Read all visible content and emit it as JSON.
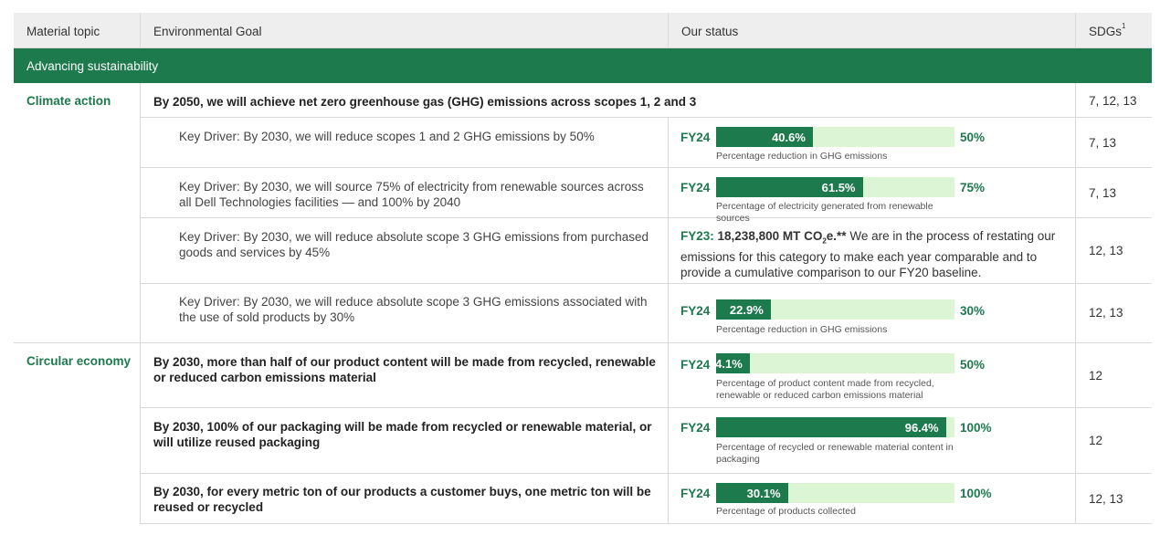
{
  "headers": {
    "topic": "Material topic",
    "goal": "Environmental Goal",
    "status": "Our status",
    "sdgs": "SDGs",
    "sdgs_sup": "1"
  },
  "section": "Advancing sustainability",
  "climate": {
    "topic": "Climate action",
    "main_goal": "By 2050, we will achieve net zero greenhouse gas (GHG) emissions across scopes 1, 2 and 3",
    "main_sdgs": "7, 12, 13",
    "drivers": [
      {
        "goal": "Key Driver: By 2030, we will reduce scopes 1 and 2 GHG emissions by 50%",
        "fy": "FY24",
        "progress": 0.406,
        "value": "40.6%",
        "target": "50%",
        "caption": "Percentage reduction in GHG emissions",
        "sdgs": "7, 13"
      },
      {
        "goal": "Key Driver: By 2030, we will source 75% of electricity from renewable sources across all Dell Technologies facilities — and 100% by 2040",
        "fy": "FY24",
        "progress": 0.615,
        "value": "61.5%",
        "target": "75%",
        "caption": "Percentage of electricity generated from renewable sources",
        "sdgs": "7, 13"
      },
      {
        "goal": "Key Driver: By 2030, we will reduce absolute scope 3 GHG emissions from purchased goods and services by 45%",
        "status_fy": "FY23:",
        "status_value": "18,238,800 MT CO",
        "status_sub": "2",
        "status_unit": "e.**",
        "status_text": "We are in the process of restating our emissions for this category to make each year comparable and to provide a cumulative comparison to our FY20 baseline.",
        "sdgs": "12, 13"
      },
      {
        "goal": "Key Driver: By 2030, we will reduce absolute scope 3 GHG emissions associated with the use of sold products by 30%",
        "fy": "FY24",
        "progress": 0.229,
        "value": "22.9%",
        "target": "30%",
        "caption": "Percentage reduction in GHG emissions",
        "sdgs": "12, 13"
      }
    ]
  },
  "circular": {
    "topic": "Circular economy",
    "goals": [
      {
        "goal": "By 2030, more than half of our product content will be made from recycled, renewable or reduced carbon emissions material",
        "fy": "FY24",
        "progress": 0.141,
        "value": "14.1%",
        "target": "50%",
        "caption": "Percentage of product content made from recycled, renewable or reduced carbon emissions material",
        "sdgs": "12"
      },
      {
        "goal": "By 2030, 100% of our packaging will be made from recycled or renewable material, or will utilize reused packaging",
        "fy": "FY24",
        "progress": 0.964,
        "value": "96.4%",
        "target": "100%",
        "caption": "Percentage of recycled or renewable material content in packaging",
        "sdgs": "12"
      },
      {
        "goal": "By 2030, for every metric ton of our products a customer buys, one metric ton will be reused or recycled",
        "fy": "FY24",
        "progress": 0.301,
        "value": "30.1%",
        "target": "100%",
        "caption": "Percentage of products collected",
        "sdgs": "12, 13"
      }
    ]
  }
}
